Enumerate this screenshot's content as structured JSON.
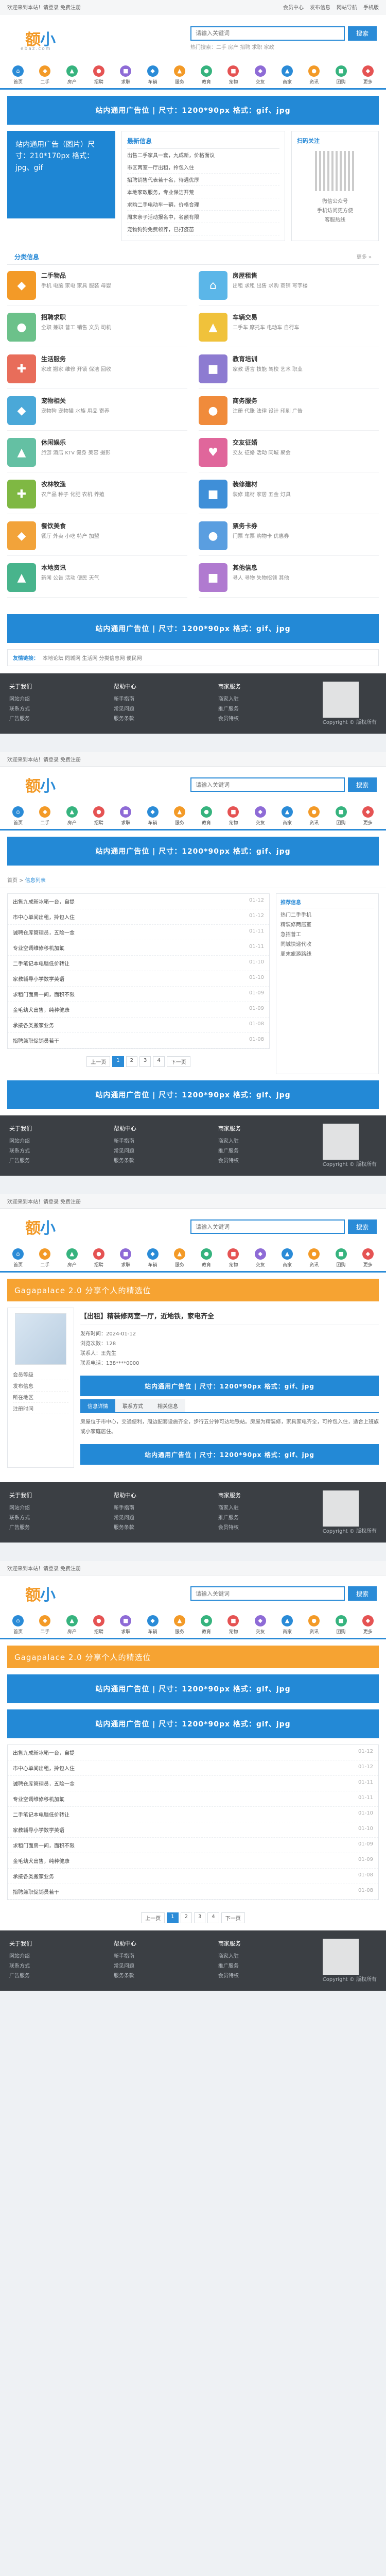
{
  "site": {
    "logo_main": "小",
    "logo_accent": "额",
    "logo_sub": "ebaz.com",
    "topbar_left": "欢迎来到本站！请登录 免费注册",
    "topbar_right": [
      "会员中心",
      "发布信息",
      "网站导航",
      "手机版"
    ],
    "search_placeholder": "请输入关键词",
    "search_button": "搜索",
    "hot_label": "热门搜索：",
    "hot_words": "二手 房产 招聘 求职 家政"
  },
  "nav": [
    {
      "label": "首页",
      "color": "#2a8bd7",
      "glyph": "⌂"
    },
    {
      "label": "二手",
      "color": "#f39a27",
      "glyph": "◆"
    },
    {
      "label": "房产",
      "color": "#36b37e",
      "glyph": "▲"
    },
    {
      "label": "招聘",
      "color": "#e55353",
      "glyph": "●"
    },
    {
      "label": "求职",
      "color": "#8e6bd6",
      "glyph": "■"
    },
    {
      "label": "车辆",
      "color": "#2a8bd7",
      "glyph": "◆"
    },
    {
      "label": "服务",
      "color": "#f39a27",
      "glyph": "▲"
    },
    {
      "label": "教育",
      "color": "#36b37e",
      "glyph": "●"
    },
    {
      "label": "宠物",
      "color": "#e55353",
      "glyph": "■"
    },
    {
      "label": "交友",
      "color": "#8e6bd6",
      "glyph": "◆"
    },
    {
      "label": "商家",
      "color": "#2a8bd7",
      "glyph": "▲"
    },
    {
      "label": "资讯",
      "color": "#f39a27",
      "glyph": "●"
    },
    {
      "label": "团购",
      "color": "#36b37e",
      "glyph": "■"
    },
    {
      "label": "更多",
      "color": "#e55353",
      "glyph": "◆"
    }
  ],
  "ad": {
    "text": "站内通用广告位 | 尺寸：1200*90px 格式：gif、jpg"
  },
  "home": {
    "slide_text": "站内通用广告（图片）尺寸：210*170px 格式：jpg、gif",
    "news_title": "最新信息",
    "news": [
      "出售二手家具一套，九成新，价格面议",
      "市区两室一厅出租，拎包入住",
      "招聘销售代表若干名，待遇优厚",
      "本地家政服务，专业保洁开荒",
      "求购二手电动车一辆，价格合理",
      "周末亲子活动报名中，名额有限",
      "宠物狗狗免费领养，已打疫苗"
    ],
    "side_title": "扫码关注",
    "side_lines": [
      "微信公众号",
      "手机访问更方便",
      "客服热线"
    ],
    "section_title": "分类信息",
    "more": "更多 »"
  },
  "categories": [
    {
      "name": "二手物品",
      "sub": "手机 电脑 家电 家具 服装 母婴",
      "color": "#f39a27",
      "glyph": "◆"
    },
    {
      "name": "房屋租售",
      "sub": "出租 求租 出售 求购 商铺 写字楼",
      "color": "#5bb6e8",
      "glyph": "⌂"
    },
    {
      "name": "招聘求职",
      "sub": "全职 兼职 普工 销售 文员 司机",
      "color": "#6cc18a",
      "glyph": "●"
    },
    {
      "name": "车辆交易",
      "sub": "二手车 摩托车 电动车 自行车",
      "color": "#f0c23b",
      "glyph": "▲"
    },
    {
      "name": "生活服务",
      "sub": "家政 搬家 维修 开锁 保洁 回收",
      "color": "#e86d5a",
      "glyph": "✚"
    },
    {
      "name": "教育培训",
      "sub": "家教 语言 技能 驾校 艺术 职业",
      "color": "#8d7bd1",
      "glyph": "■"
    },
    {
      "name": "宠物相关",
      "sub": "宠物狗 宠物猫 水族 用品 寄养",
      "color": "#4aa8d8",
      "glyph": "◆"
    },
    {
      "name": "商务服务",
      "sub": "注册 代账 法律 设计 印刷 广告",
      "color": "#f08b3b",
      "glyph": "●"
    },
    {
      "name": "休闲娱乐",
      "sub": "旅游 酒店 KTV 健身 美容 摄影",
      "color": "#64c0a3",
      "glyph": "▲"
    },
    {
      "name": "交友征婚",
      "sub": "交友 征婚 活动 同城 聚会",
      "color": "#e0669b",
      "glyph": "♥"
    },
    {
      "name": "农林牧渔",
      "sub": "农产品 种子 化肥 农机 养殖",
      "color": "#7fb843",
      "glyph": "✚"
    },
    {
      "name": "装修建材",
      "sub": "装修 建材 家居 五金 灯具",
      "color": "#3f8fd8",
      "glyph": "■"
    },
    {
      "name": "餐饮美食",
      "sub": "餐厅 外卖 小吃 特产 加盟",
      "color": "#f2a33a",
      "glyph": "◆"
    },
    {
      "name": "票务卡券",
      "sub": "门票 车票 购物卡 优惠券",
      "color": "#5a9ee0",
      "glyph": "●"
    },
    {
      "name": "本地资讯",
      "sub": "新闻 公告 活动 便民 天气",
      "color": "#48b48c",
      "glyph": "▲"
    },
    {
      "name": "其他信息",
      "sub": "寻人 寻物 失物招领 其他",
      "color": "#b07ad0",
      "glyph": "■"
    }
  ],
  "friend": {
    "label": "友情链接：",
    "links": "本地论坛 同城网 生活网 分类信息网 便民网"
  },
  "footer": {
    "cols": [
      {
        "h": "关于我们",
        "lines": [
          "网站介绍",
          "联系方式",
          "广告服务"
        ]
      },
      {
        "h": "帮助中心",
        "lines": [
          "新手指南",
          "常见问题",
          "服务条款"
        ]
      },
      {
        "h": "商家服务",
        "lines": [
          "商家入驻",
          "推广服务",
          "会员特权"
        ]
      }
    ],
    "copyright": "Copyright © 版权所有"
  },
  "listpage": {
    "crumb_home": "首页",
    "crumb_sep": " > ",
    "crumb_here": "信息列表",
    "rows": [
      {
        "t": "出售九成新冰箱一台，自提",
        "d": "01-12"
      },
      {
        "t": "市中心单间出租，拎包入住",
        "d": "01-12"
      },
      {
        "t": "诚聘仓库管理员，五险一金",
        "d": "01-11"
      },
      {
        "t": "专业空调维修移机加氟",
        "d": "01-11"
      },
      {
        "t": "二手笔记本电脑低价转让",
        "d": "01-10"
      },
      {
        "t": "家教辅导小学数学英语",
        "d": "01-10"
      },
      {
        "t": "求租门面房一间，面积不限",
        "d": "01-09"
      },
      {
        "t": "金毛幼犬出售，纯种健康",
        "d": "01-09"
      },
      {
        "t": "承接各类搬家业务",
        "d": "01-08"
      },
      {
        "t": "招聘兼职促销员若干",
        "d": "01-08"
      }
    ],
    "aside_title": "推荐信息",
    "aside_lines": [
      "热门二手手机",
      "精装修两居室",
      "急招普工",
      "同城快递代收",
      "周末旅游路线"
    ],
    "pages": [
      "上一页",
      "1",
      "2",
      "3",
      "4",
      "下一页"
    ]
  },
  "detailpage": {
    "banner": "Gagapalace 2.0 分享个人的精选位",
    "title": "【出租】精装修两室一厅，近地铁，家电齐全",
    "info": [
      "发布时间：2024-01-12",
      "浏览次数：128",
      "联系人：王先生",
      "联系电话：138****0000"
    ],
    "left_lines": [
      "会员等级",
      "发布信息",
      "所在地区",
      "注册时间"
    ],
    "tabs": [
      "信息详情",
      "联系方式",
      "相关信息"
    ],
    "text": "房屋位于市中心，交通便利，周边配套设施齐全，步行五分钟可达地铁站。房屋为精装修，家具家电齐全，可拎包入住，适合上班族或小家庭居住。"
  }
}
